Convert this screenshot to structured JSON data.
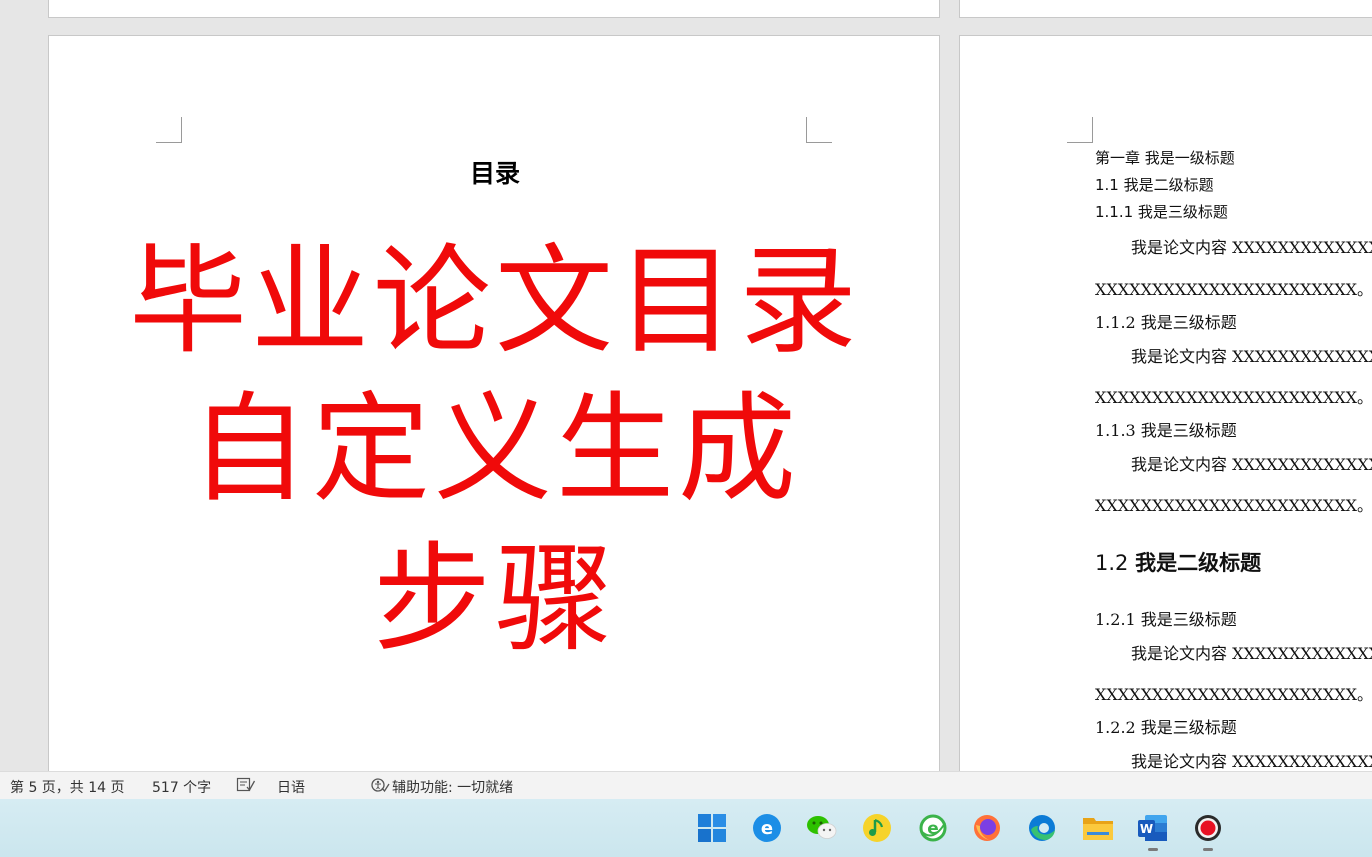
{
  "left_page": {
    "toc_title": "目录",
    "overlay": [
      "毕业论文目录",
      "自定义生成",
      "步骤"
    ]
  },
  "right_page": {
    "lines": [
      "第一章  我是一级标题",
      "1.1 我是二级标题",
      "1.1.1 我是三级标题",
      "我是论文内容 XXXXXXXXXXXXXXXXXXXXXXXXX",
      "XXXXXXXXXXXXXXXXXXXXXXX。",
      "1.1.2 我是三级标题",
      "我是论文内容 XXXXXXXXXXXXXXXXXXXXXXXXX",
      "XXXXXXXXXXXXXXXXXXXXXXX。",
      "1.1.3 我是三级标题",
      "我是论文内容 XXXXXXXXXXXXXXXXXXXXXXXXX",
      "XXXXXXXXXXXXXXXXXXXXXXX。",
      "1.2.1 我是三级标题",
      "我是论文内容 XXXXXXXXXXXXXXXXXXXXXXXXX",
      "XXXXXXXXXXXXXXXXXXXXXXX。",
      "1.2.2 我是三级标题",
      "我是论文内容 XXXXXXXXXXXXXXXXXXXXXXXXX"
    ],
    "heading2_number": "1.2",
    "heading2_text": "我是二级标题"
  },
  "status": {
    "page_info": "第 5 页，共 14 页",
    "word_count": "517 个字",
    "language": "日语",
    "accessibility": "辅助功能: 一切就绪"
  },
  "taskbar": {
    "icons": [
      "windows-start-icon",
      "ie-browser-icon",
      "wechat-icon",
      "qq-music-icon",
      "360-browser-icon",
      "firefox-icon",
      "edge-icon",
      "file-explorer-icon",
      "word-icon",
      "screen-recorder-icon"
    ]
  },
  "colors": {
    "overlay_red": "#f00a0a",
    "word_blue": "#185abd"
  }
}
